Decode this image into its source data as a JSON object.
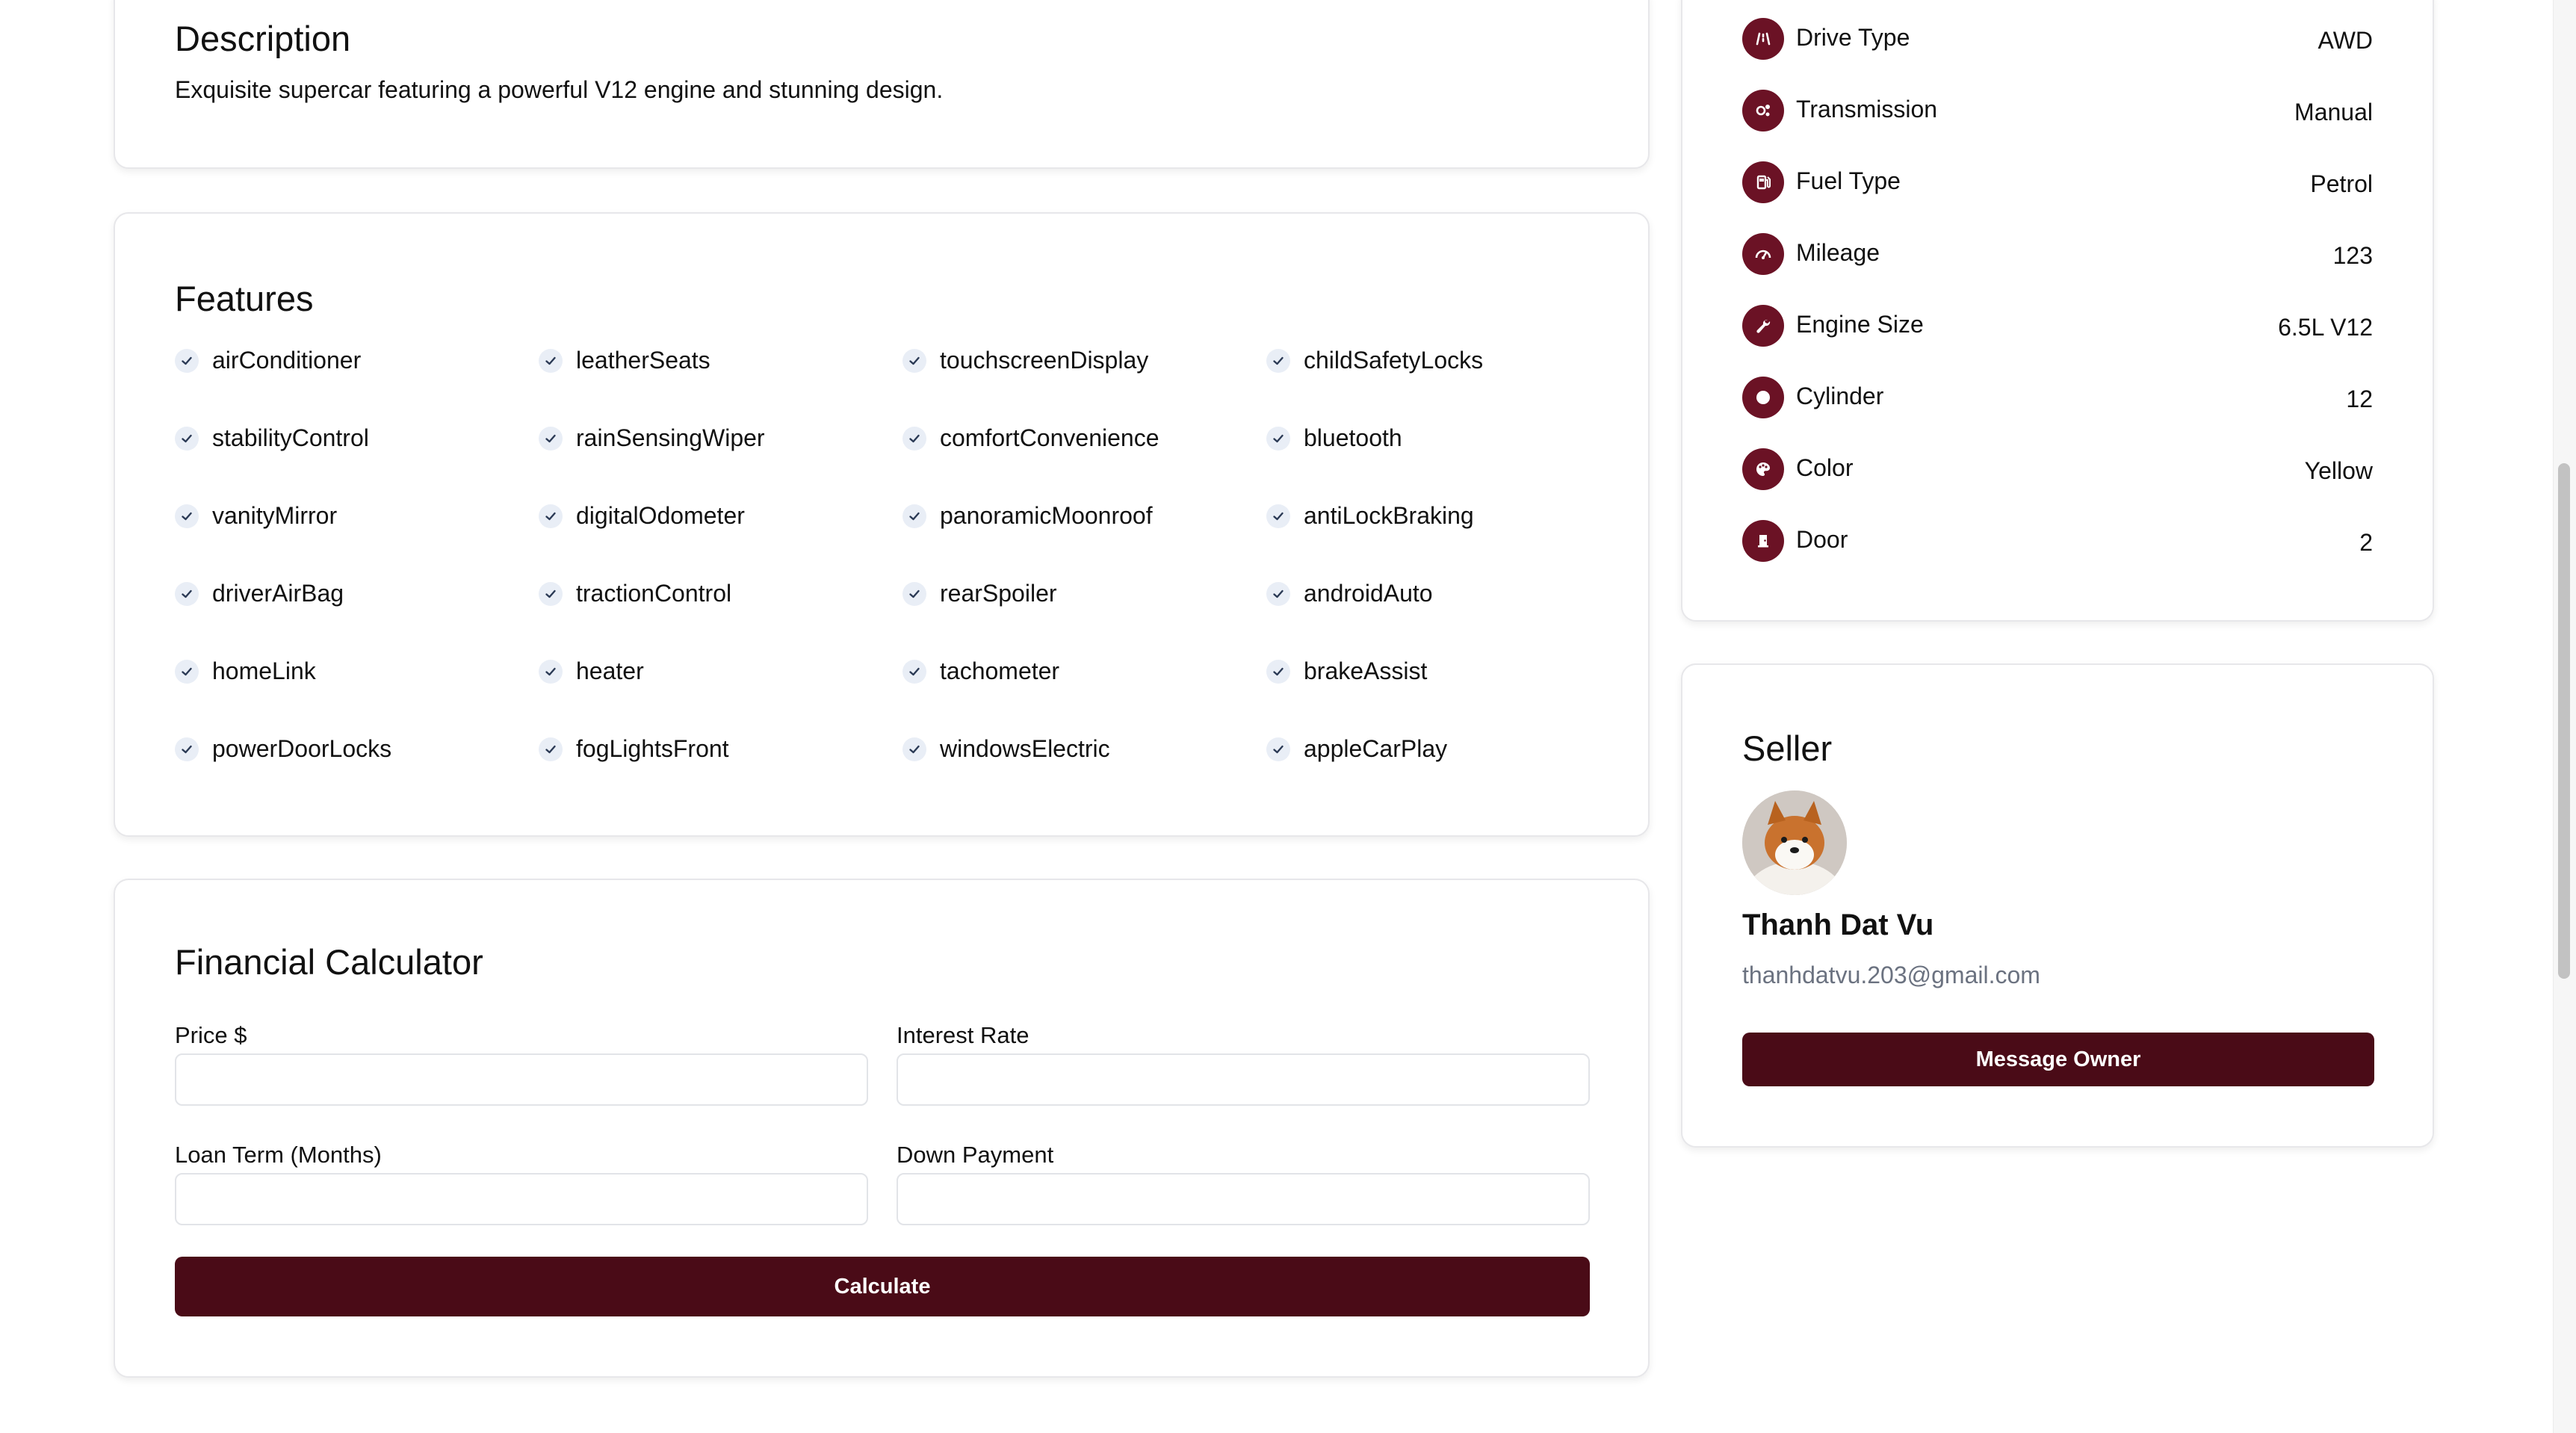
{
  "description": {
    "title": "Description",
    "text": "Exquisite supercar featuring a powerful V12 engine and stunning design."
  },
  "features": {
    "title": "Features",
    "items": [
      "airConditioner",
      "leatherSeats",
      "touchscreenDisplay",
      "childSafetyLocks",
      "stabilityControl",
      "rainSensingWiper",
      "comfortConvenience",
      "bluetooth",
      "vanityMirror",
      "digitalOdometer",
      "panoramicMoonroof",
      "antiLockBraking",
      "driverAirBag",
      "tractionControl",
      "rearSpoiler",
      "androidAuto",
      "homeLink",
      "heater",
      "tachometer",
      "brakeAssist",
      "powerDoorLocks",
      "fogLightsFront",
      "windowsElectric",
      "appleCarPlay"
    ]
  },
  "calculator": {
    "title": "Financial Calculator",
    "price_label": "Price $",
    "interest_label": "Interest Rate",
    "loan_label": "Loan Term (Months)",
    "down_label": "Down Payment",
    "calculate_label": "Calculate"
  },
  "specs": [
    {
      "label": "Drive Type",
      "value": "AWD",
      "icon": "road-icon"
    },
    {
      "label": "Transmission",
      "value": "Manual",
      "icon": "gears-icon"
    },
    {
      "label": "Fuel Type",
      "value": "Petrol",
      "icon": "gas-pump-icon"
    },
    {
      "label": "Mileage",
      "value": "123",
      "icon": "gauge-icon"
    },
    {
      "label": "Engine Size",
      "value": "6.5L V12",
      "icon": "wrench-icon"
    },
    {
      "label": "Cylinder",
      "value": "12",
      "icon": "circle-icon"
    },
    {
      "label": "Color",
      "value": "Yellow",
      "icon": "palette-icon"
    },
    {
      "label": "Door",
      "value": "2",
      "icon": "door-icon"
    }
  ],
  "seller": {
    "title": "Seller",
    "name": "Thanh Dat Vu",
    "email": "thanhdatvu.203@gmail.com",
    "message_label": "Message Owner",
    "avatar_icon": "shiba-dog-avatar"
  },
  "colors": {
    "accent": "#4a0b17",
    "icon_bg": "#6b1225",
    "check_bg": "#e9eef6"
  }
}
